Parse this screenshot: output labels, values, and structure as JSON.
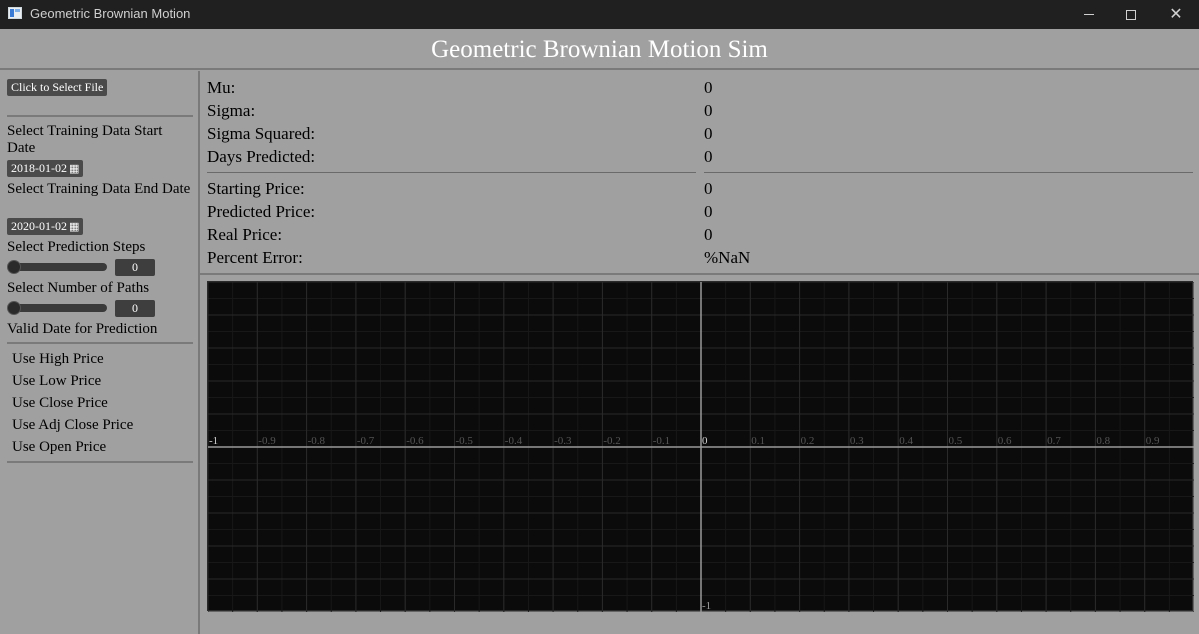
{
  "window": {
    "title": "Geometric Brownian Motion"
  },
  "app": {
    "heading": "Geometric Brownian Motion Sim"
  },
  "sidebar": {
    "select_file_label": "Click to Select File",
    "start_date_label": "Select Training Data Start Date",
    "start_date": "2018-01-02",
    "end_date_label": "Select Training Data End Date",
    "end_date": "2020-01-02",
    "prediction_steps_label": "Select Prediction Steps",
    "prediction_steps_value": "0",
    "paths_label": "Select Number of Paths",
    "paths_value": "0",
    "valid_date_label": "Valid Date for Prediction",
    "price_options": [
      "Use High Price",
      "Use Low Price",
      "Use Close Price",
      "Use Adj Close Price",
      "Use Open Price"
    ]
  },
  "stats": {
    "group1": [
      {
        "label": "Mu:",
        "value": "0"
      },
      {
        "label": "Sigma:",
        "value": "0"
      },
      {
        "label": "Sigma Squared:",
        "value": "0"
      },
      {
        "label": "Days Predicted:",
        "value": "0"
      }
    ],
    "group2": [
      {
        "label": "Starting Price:",
        "value": "0"
      },
      {
        "label": "Predicted Price:",
        "value": "0"
      },
      {
        "label": "Real Price:",
        "value": "0"
      },
      {
        "label": "Percent Error:",
        "value": "%NaN"
      }
    ]
  },
  "chart_data": {
    "type": "line",
    "x_ticks": [
      "-1",
      "-0.9",
      "-0.8",
      "-0.7",
      "-0.6",
      "-0.5",
      "-0.4",
      "-0.3",
      "-0.2",
      "-0.1",
      "0",
      "0.1",
      "0.2",
      "0.3",
      "0.4",
      "0.5",
      "0.6",
      "0.7",
      "0.8",
      "0.9"
    ],
    "y_tick_bottom": "-1",
    "xlim": [
      -1,
      1
    ],
    "ylim": [
      -1,
      1
    ],
    "grid": true,
    "series": []
  },
  "colors": {
    "background": "#a0a0a0",
    "chart_bg": "#0b0b0b",
    "titlebar": "#202020"
  }
}
